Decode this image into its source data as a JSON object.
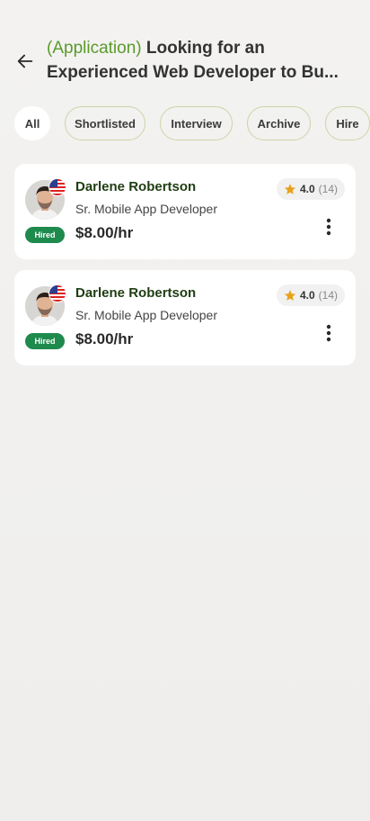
{
  "header": {
    "tag": "(Application)",
    "title_rest_line1": " Looking for an",
    "title_line2": "Experienced Web Developer to Bu..."
  },
  "filters": [
    "All",
    "Shortlisted",
    "Interview",
    "Archive",
    "Hire"
  ],
  "applicants": [
    {
      "name": "Darlene Robertson",
      "role": "Sr. Mobile App Developer",
      "rate": "$8.00/hr",
      "status": "Hired",
      "rating": "4.0",
      "reviews": "(14)"
    },
    {
      "name": "Darlene Robertson",
      "role": "Sr. Mobile App Developer",
      "rate": "$8.00/hr",
      "status": "Hired",
      "rating": "4.0",
      "reviews": "(14)"
    }
  ],
  "colors": {
    "accent_green": "#5a9a2b",
    "hired_badge": "#1e8a4e",
    "star": "#e8a21a",
    "name": "#1f3d12"
  },
  "icons": {
    "back": "arrow-left-icon",
    "star": "star-icon",
    "more": "more-vertical-icon",
    "flag": "us-flag-icon"
  }
}
